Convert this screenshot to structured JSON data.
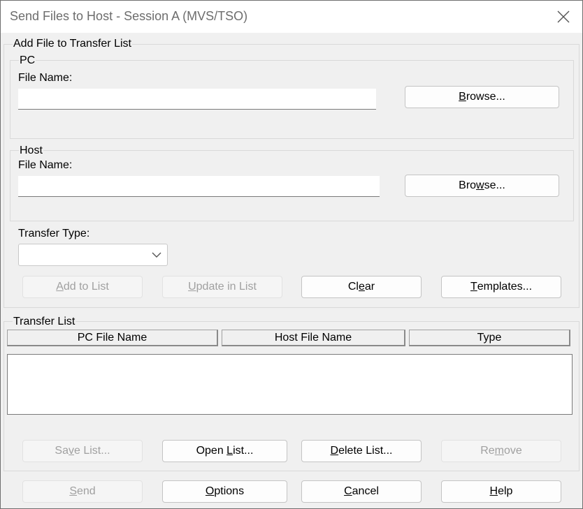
{
  "window": {
    "title": "Send Files to Host - Session A (MVS/TSO)"
  },
  "add_group": {
    "title": "Add File to Transfer List",
    "pc": {
      "title": "PC",
      "label": "File Name:",
      "value": "",
      "browse_pre": "",
      "browse_key": "B",
      "browse_post": "rowse..."
    },
    "host": {
      "title": "Host",
      "label": "File Name:",
      "value": "",
      "browse_pre": "Bro",
      "browse_key": "w",
      "browse_post": "se..."
    },
    "transfer_type": {
      "label": "Transfer Type:",
      "value": ""
    },
    "buttons": {
      "add": {
        "pre": "",
        "key": "A",
        "post": "dd to List",
        "enabled": false
      },
      "update": {
        "pre": "",
        "key": "U",
        "post": "pdate in List",
        "enabled": false
      },
      "clear": {
        "pre": "Cl",
        "key": "e",
        "post": "ar",
        "enabled": true
      },
      "templates": {
        "pre": "",
        "key": "T",
        "post": "emplates...",
        "enabled": true
      }
    }
  },
  "transfer_list": {
    "title": "Transfer List",
    "columns": [
      "PC File Name",
      "Host File Name",
      "Type"
    ],
    "rows": []
  },
  "list_buttons": {
    "save": {
      "pre": "Sa",
      "key": "v",
      "post": "e List...",
      "enabled": false
    },
    "open": {
      "pre": "Open ",
      "key": "L",
      "post": "ist...",
      "enabled": true
    },
    "delete": {
      "pre": "",
      "key": "D",
      "post": "elete List...",
      "enabled": true
    },
    "remove": {
      "pre": "Re",
      "key": "m",
      "post": "ove",
      "enabled": false
    }
  },
  "bottom_buttons": {
    "send": {
      "pre": "",
      "key": "S",
      "post": "end",
      "enabled": false
    },
    "options": {
      "pre": "",
      "key": "O",
      "post": "ptions",
      "enabled": true
    },
    "cancel": {
      "pre": "",
      "key": "C",
      "post": "ancel",
      "enabled": true
    },
    "help": {
      "pre": "",
      "key": "H",
      "post": "elp",
      "enabled": true
    }
  },
  "icons": {
    "close": "close-icon",
    "dropdown": "chevron-down-icon"
  },
  "colors": {
    "title_text": "#6d6d6d",
    "dialog_bg": "#f0f0f0",
    "disabled_text": "#a0a0a0"
  }
}
